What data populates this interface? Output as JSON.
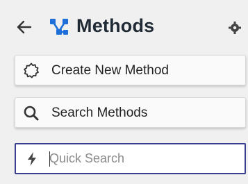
{
  "header": {
    "title": "Methods",
    "back_icon": "arrow-left-icon",
    "logo_icon": "methods-logo-icon",
    "settings_icon": "settings-icon"
  },
  "actions": {
    "create": {
      "label": "Create New Method",
      "icon": "gear-outline-icon"
    },
    "search": {
      "label": "Search Methods",
      "icon": "search-icon"
    }
  },
  "quick_search": {
    "placeholder": "Quick Search",
    "value": "",
    "icon": "lightning-icon"
  },
  "colors": {
    "background": "#f0f0f0",
    "title": "#1f2a35",
    "accent_blue": "#1e6fd9",
    "input_border": "#3a3f8f"
  }
}
